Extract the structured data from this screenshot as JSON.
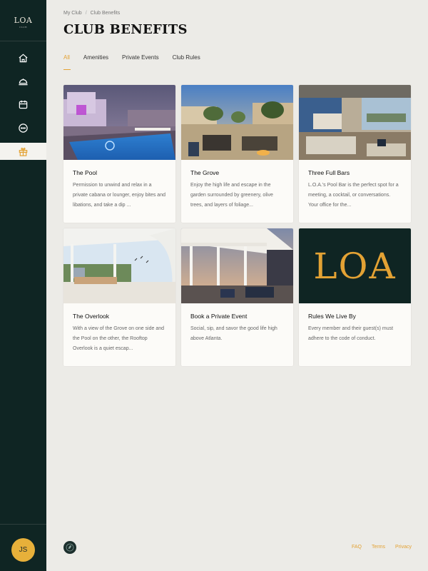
{
  "sidebar": {
    "logo_text": "LOA",
    "logo_subtext": "CLUB",
    "nav": [
      {
        "icon": "home-icon"
      },
      {
        "icon": "dining-icon"
      },
      {
        "icon": "calendar-icon"
      },
      {
        "icon": "chat-icon"
      },
      {
        "icon": "gift-icon",
        "active": true
      }
    ],
    "user_initials": "JS"
  },
  "breadcrumb": {
    "items": [
      "My Club",
      "Club Benefits"
    ],
    "separator": "/"
  },
  "page_title": "CLUB BENEFITS",
  "tabs": [
    {
      "label": "All",
      "active": true
    },
    {
      "label": "Amenities"
    },
    {
      "label": "Private Events"
    },
    {
      "label": "Club Rules"
    }
  ],
  "cards": [
    {
      "title": "The Pool",
      "desc": "Permission to unwind and relax in a private cabana or lounger, enjoy bites and libations, and take a dip ..."
    },
    {
      "title": "The Grove",
      "desc": "Enjoy the high life and escape in the garden surrounded by greenery, olive trees, and layers of foliage..."
    },
    {
      "title": "Three Full Bars",
      "desc": "L.O.A.'s Pool Bar is the perfect spot for a meeting, a cocktail, or conversations. Your office for the..."
    },
    {
      "title": "The Overlook",
      "desc": "With a view of the Grove on one side and the Pool on the other, the Rooftop Overlook is a quiet escap..."
    },
    {
      "title": "Book a Private Event",
      "desc": "Social, sip, and savor the good life high above Atlanta."
    },
    {
      "title": "Rules We Live By",
      "desc": "Every member and their guest(s) must adhere to the code of conduct.",
      "image_text": "LOA"
    }
  ],
  "footer": {
    "links": [
      "FAQ",
      "Terms",
      "Privacy"
    ]
  },
  "colors": {
    "sidebar_bg": "#0f2523",
    "accent": "#e3a234",
    "page_bg": "#ecebe7"
  }
}
